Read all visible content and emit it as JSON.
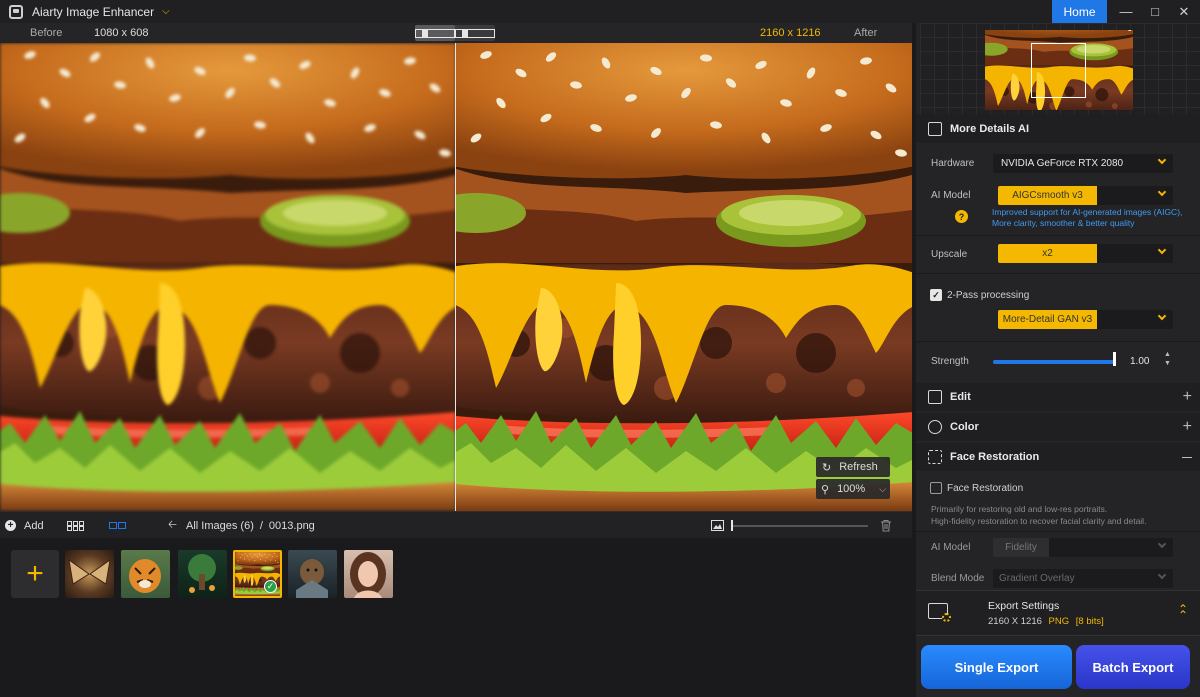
{
  "app": {
    "title": "Aiarty Image Enhancer",
    "home_label": "Home"
  },
  "compare": {
    "before_label": "Before",
    "before_resolution": "1080 x 608",
    "after_resolution": "2160 x 1216",
    "after_label": "After"
  },
  "viewer": {
    "refresh_label": "Refresh",
    "zoom_label": "100%"
  },
  "toolbar": {
    "add_label": "Add",
    "breadcrumb_root": "All Images (6)",
    "breadcrumb_sep": "/",
    "breadcrumb_file": "0013.png",
    "zoom_value": 0.0
  },
  "thumbnails": [
    {
      "name": "butterfly",
      "selected": false
    },
    {
      "name": "tiger",
      "selected": false
    },
    {
      "name": "forest-tree",
      "selected": false
    },
    {
      "name": "burger",
      "selected": true
    },
    {
      "name": "dog-armor",
      "selected": false
    },
    {
      "name": "portrait",
      "selected": false
    }
  ],
  "panel": {
    "more_details": {
      "title": "More Details AI",
      "hardware_label": "Hardware",
      "hardware_value": "NVIDIA GeForce RTX 2080",
      "model_label": "AI Model",
      "model_value": "AIGCsmooth  v3",
      "model_info_1": "Improved support for AI-generated images (AIGC),",
      "model_info_2": "More clarity, smoother & better quality",
      "upscale_label": "Upscale",
      "upscale_value": "x2",
      "twopass_label": "2-Pass processing",
      "twopass_checked": true,
      "twopass_model": "More-Detail GAN  v3",
      "strength_label": "Strength",
      "strength_value": "1.00",
      "strength_fraction": 1.0
    },
    "edit": {
      "title": "Edit"
    },
    "color": {
      "title": "Color"
    },
    "face": {
      "title": "Face Restoration",
      "checkbox_label": "Face Restoration",
      "checked": false,
      "desc_1": "Primarily for restoring old and low-res portraits.",
      "desc_2": "High-fidelity restoration to recover facial clarity and detail.",
      "model_label": "AI Model",
      "model_value": "Fidelity",
      "blend_label": "Blend Mode",
      "blend_value": "Gradient Overlay"
    },
    "export": {
      "title": "Export Settings",
      "resolution": "2160 X 1216",
      "format": "PNG",
      "bits": "[8 bits]",
      "single_label": "Single Export",
      "batch_label": "Batch Export"
    }
  },
  "colors": {
    "accent": "#f5b800",
    "primary": "#1f78e6",
    "batch": "#3a43dc"
  }
}
